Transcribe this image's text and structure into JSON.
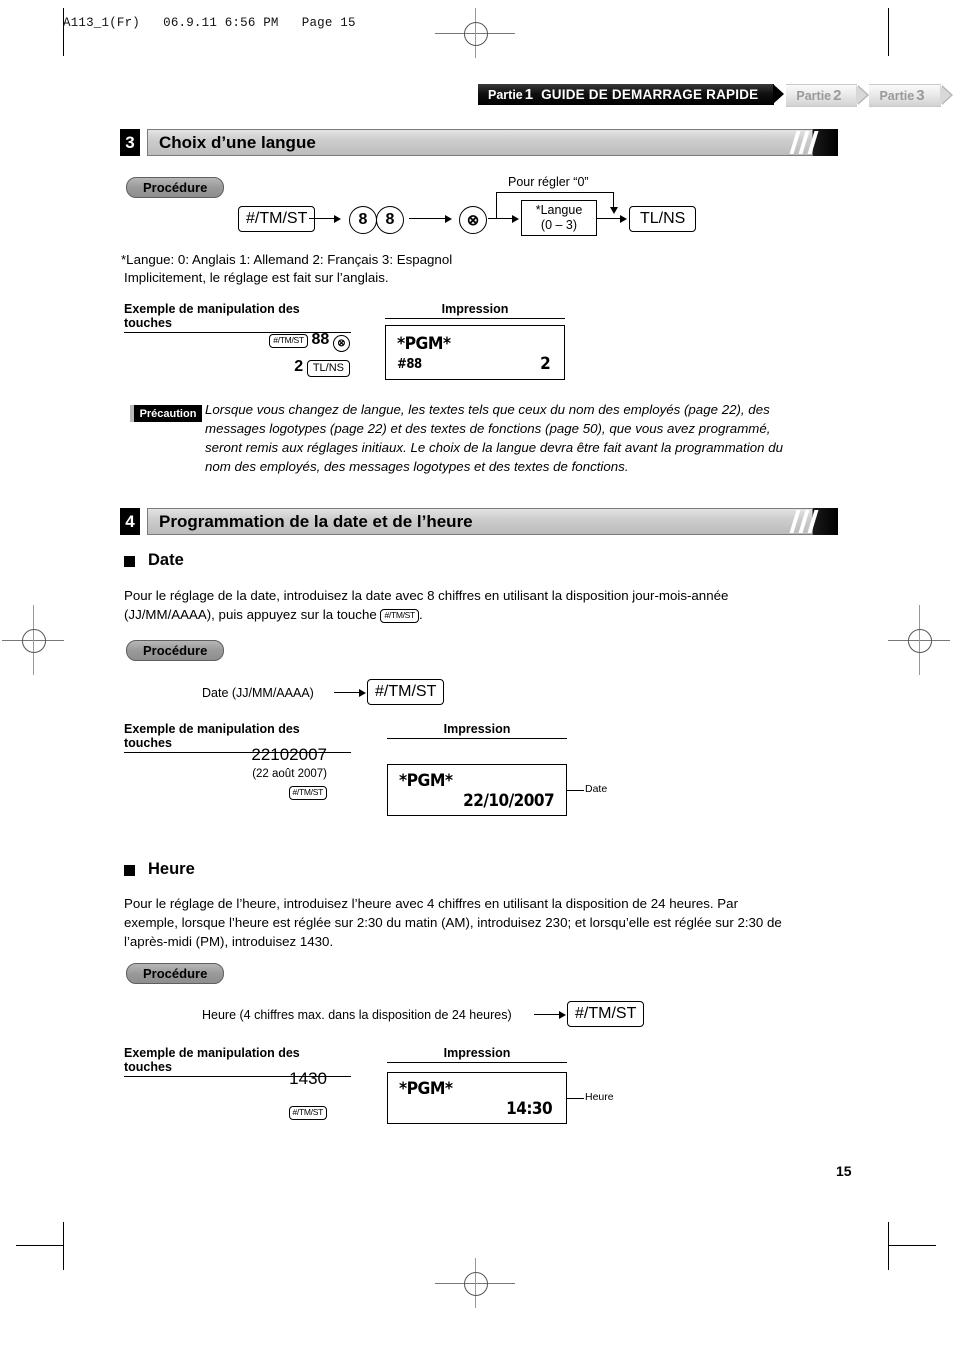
{
  "page": {
    "file_header": "A113_1(Fr)   06.9.11 6:56 PM   Page 15",
    "page_number": "15"
  },
  "tabs": [
    {
      "prefix": "Partie",
      "num": "1",
      "label": "GUIDE DE DEMARRAGE RAPIDE",
      "active": true
    },
    {
      "prefix": "Partie",
      "num": "2",
      "label": "",
      "active": false
    },
    {
      "prefix": "Partie",
      "num": "3",
      "label": "",
      "active": false
    }
  ],
  "section3": {
    "number": "3",
    "title": "Choix d’une langue",
    "procedure_label": "Procédure",
    "flow": {
      "key1": "#/TM/ST",
      "digit1": "8",
      "digit2": "8",
      "multiply": "⊗",
      "box_line1": "*Langue",
      "box_line2": "(0 – 3)",
      "key_end": "TL/NS",
      "bypass_label": "Pour régler “0”"
    },
    "note_line1": "*Langue:  0: Anglais    1: Allemand     2: Français     3: Espagnol",
    "note_line2": "Implicitement, le réglage est fait sur l’anglais.",
    "example_header": "Exemple de manipulation des touches",
    "impression_header": "Impression",
    "example": {
      "key1": "#/TM/ST",
      "value1": "88",
      "multiply": "⊗",
      "value2": "2",
      "key2": "TL/NS"
    },
    "receipt": {
      "line1": "*PGM*",
      "line2_left": "#88",
      "line2_right": "2"
    },
    "caution": {
      "badge": "Précaution",
      "line1": "Lorsque vous changez de langue, les textes tels que ceux du nom des employés (page 22), des",
      "line2": "messages logotypes (page 22) et des textes de fonctions (page 50), que vous avez programmé,",
      "line3": "seront remis aux réglages initiaux. Le choix de la langue devra être fait avant la programmation du",
      "line4": "nom des employés, des messages logotypes et des textes de fonctions."
    }
  },
  "section4": {
    "number": "4",
    "title": "Programmation de la date et de l’heure",
    "date": {
      "heading": "Date",
      "body_line1": "Pour le réglage de la date, introduisez la date avec 8 chiffres en utilisant la disposition jour-mois-année",
      "body_line2_pre": "(JJ/MM/AAAA), puis appuyez sur la touche ",
      "body_key": "#/TM/ST",
      "body_line2_post": ".",
      "procedure_label": "Procédure",
      "flow_label": "Date (JJ/MM/AAAA)",
      "flow_key": "#/TM/ST",
      "example_header": "Exemple de manipulation des touches",
      "impression_header": "Impression",
      "example_value": "22102007",
      "example_note": "(22 août 2007)",
      "example_key": "#/TM/ST",
      "receipt": {
        "line1": "*PGM*",
        "line2_right": "22/10/2007"
      },
      "callout": "Date"
    },
    "time": {
      "heading": "Heure",
      "body_line1": "Pour le réglage de l’heure, introduisez l’heure avec 4 chiffres en utilisant la disposition de 24 heures. Par",
      "body_line2": "exemple, lorsque l’heure est réglée sur 2:30 du matin (AM), introduisez 230; et lorsqu’elle est réglée sur 2:30 de",
      "body_line3": "l’après-midi (PM), introduisez 1430.",
      "procedure_label": "Procédure",
      "flow_label": "Heure (4 chiffres max. dans la disposition de 24 heures)",
      "flow_key": "#/TM/ST",
      "example_header": "Exemple de manipulation des touches",
      "impression_header": "Impression",
      "example_value": "1430",
      "example_key": "#/TM/ST",
      "receipt": {
        "line1": "*PGM*",
        "line2_right": "14:30"
      },
      "callout": "Heure"
    }
  }
}
